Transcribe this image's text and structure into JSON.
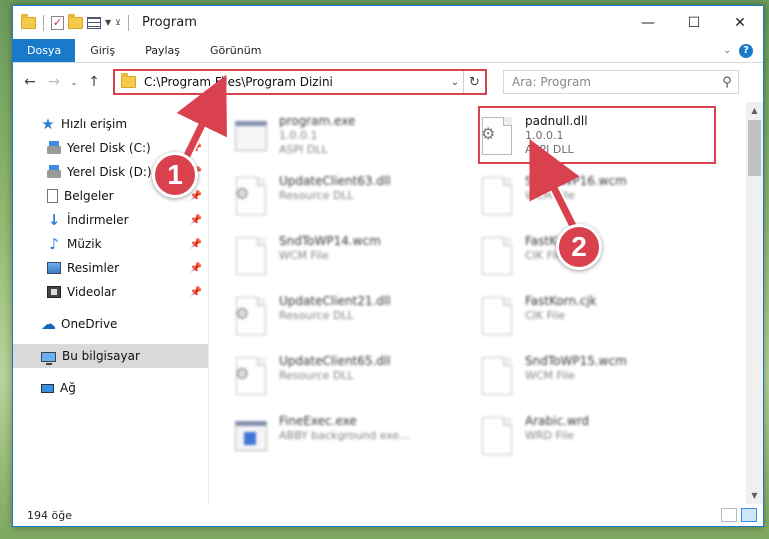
{
  "window": {
    "title": "Program"
  },
  "ribbon": {
    "tabs": [
      "Dosya",
      "Giriş",
      "Paylaş",
      "Görünüm"
    ]
  },
  "address": {
    "path": "C:\\Program Files\\Program Dizini"
  },
  "search": {
    "placeholder": "Ara: Program"
  },
  "sidebar": {
    "items": [
      {
        "label": "Hızlı erişim",
        "icon": "star-icon"
      },
      {
        "label": "Yerel Disk (C:)",
        "icon": "drive-icon"
      },
      {
        "label": "Yerel Disk (D:)",
        "icon": "drive-icon"
      },
      {
        "label": "Belgeler",
        "icon": "documents-icon"
      },
      {
        "label": "İndirmeler",
        "icon": "downloads-icon"
      },
      {
        "label": "Müzik",
        "icon": "music-icon"
      },
      {
        "label": "Resimler",
        "icon": "pictures-icon"
      },
      {
        "label": "Videolar",
        "icon": "videos-icon"
      },
      {
        "label": "OneDrive",
        "icon": "onedrive-icon"
      },
      {
        "label": "Bu bilgisayar",
        "icon": "computer-icon"
      },
      {
        "label": "Ağ",
        "icon": "network-icon"
      }
    ]
  },
  "files": [
    {
      "name": "program.exe",
      "l2": "1.0.0.1",
      "l3": "ASPI DLL",
      "icon": "exe-icon"
    },
    {
      "name": "padnull.dll",
      "l2": "1.0.0.1",
      "l3": "ASPI DLL",
      "icon": "dll-icon"
    },
    {
      "name": "UpdateClient63.dll",
      "l2": "Resource DLL",
      "l3": "",
      "icon": "dll-icon"
    },
    {
      "name": "SndToWP16.wcm",
      "l2": "WCM File",
      "l3": "",
      "icon": "file-icon"
    },
    {
      "name": "SndToWP14.wcm",
      "l2": "WCM File",
      "l3": "",
      "icon": "file-icon"
    },
    {
      "name": "FastKor.cik",
      "l2": "CIK File",
      "l3": "",
      "icon": "file-icon"
    },
    {
      "name": "UpdateClient21.dll",
      "l2": "Resource DLL",
      "l3": "",
      "icon": "dll-icon"
    },
    {
      "name": "FastKorn.cjk",
      "l2": "CIK File",
      "l3": "",
      "icon": "file-icon"
    },
    {
      "name": "UpdateClient65.dll",
      "l2": "Resource DLL",
      "l3": "",
      "icon": "dll-icon"
    },
    {
      "name": "SndToWP15.wcm",
      "l2": "WCM File",
      "l3": "",
      "icon": "file-icon"
    },
    {
      "name": "FineExec.exe",
      "l2": "ABBY background exe...",
      "l3": "",
      "icon": "exe-icon"
    },
    {
      "name": "Arabic.wrd",
      "l2": "WRD File",
      "l3": "",
      "icon": "file-icon"
    }
  ],
  "status": {
    "count": "194 öğe"
  },
  "callouts": [
    "1",
    "2"
  ],
  "colors": {
    "accent": "#1979ca",
    "highlight": "#d9414f"
  }
}
